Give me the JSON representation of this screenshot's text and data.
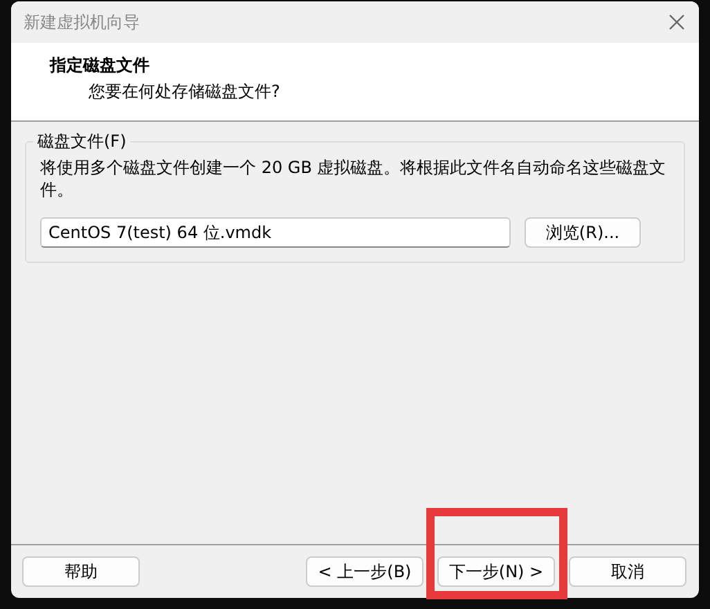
{
  "window": {
    "title": "新建虚拟机向导"
  },
  "header": {
    "title": "指定磁盘文件",
    "subtitle": "您要在何处存储磁盘文件?"
  },
  "disk_file_group": {
    "label": "磁盘文件(F)",
    "description": "将使用多个磁盘文件创建一个 20 GB 虚拟磁盘。将根据此文件名自动命名这些磁盘文件。",
    "file_name": "CentOS 7(test) 64 位.vmdk",
    "browse_button": "浏览(R)..."
  },
  "buttons": [
    {
      "label": "帮助",
      "kind": "help"
    },
    {
      "label": "< 上一步(B)",
      "kind": "nav"
    },
    {
      "label": "下一步(N) >",
      "kind": "nav"
    },
    {
      "label": "取消",
      "kind": "nav"
    }
  ],
  "annotation": {
    "highlight": true
  }
}
